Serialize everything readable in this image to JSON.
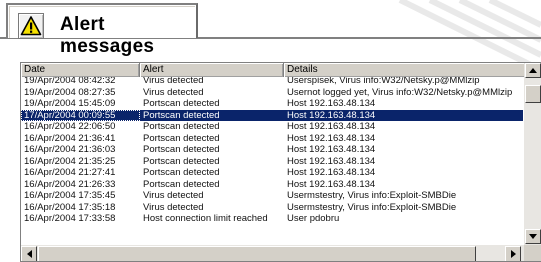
{
  "header": {
    "title": "Alert messages",
    "icon": "warning-triangle-icon"
  },
  "list": {
    "columns": [
      "Date",
      "Alert",
      "Details"
    ],
    "rows": [
      {
        "date": "19/Apr/2004 08:42:32",
        "alert": "Virus detected",
        "details": "Userspisek, Virus info:W32/Netsky.p@MMlzip",
        "selected": false
      },
      {
        "date": "19/Apr/2004 08:27:35",
        "alert": "Virus detected",
        "details": "Usernot logged yet, Virus info:W32/Netsky.p@MMlzip",
        "selected": false
      },
      {
        "date": "19/Apr/2004 15:45:09",
        "alert": "Portscan detected",
        "details": "Host 192.163.48.134",
        "selected": false
      },
      {
        "date": "17/Apr/2004 00:09:55",
        "alert": "Portscan detected",
        "details": "Host 192.163.48.134",
        "selected": true
      },
      {
        "date": "16/Apr/2004 22:06:50",
        "alert": "Portscan detected",
        "details": "Host 192.163.48.134",
        "selected": false
      },
      {
        "date": "16/Apr/2004 21:36:41",
        "alert": "Portscan detected",
        "details": "Host 192.163.48.134",
        "selected": false
      },
      {
        "date": "16/Apr/2004 21:36:03",
        "alert": "Portscan detected",
        "details": "Host 192.163.48.134",
        "selected": false
      },
      {
        "date": "16/Apr/2004 21:35:25",
        "alert": "Portscan detected",
        "details": "Host 192.163.48.134",
        "selected": false
      },
      {
        "date": "16/Apr/2004 21:27:41",
        "alert": "Portscan detected",
        "details": "Host 192.163.48.134",
        "selected": false
      },
      {
        "date": "16/Apr/2004 21:26:33",
        "alert": "Portscan detected",
        "details": "Host 192.163.48.134",
        "selected": false
      },
      {
        "date": "16/Apr/2004 17:35:45",
        "alert": "Virus detected",
        "details": "Usermstestry, Virus info:Exploit-SMBDie",
        "selected": false
      },
      {
        "date": "16/Apr/2004 17:35:18",
        "alert": "Virus detected",
        "details": "Usermstestry, Virus info:Exploit-SMBDie",
        "selected": false
      },
      {
        "date": "16/Apr/2004 17:33:58",
        "alert": "Host connection limit reached",
        "details": "User pdobru",
        "selected": false
      }
    ]
  },
  "colors": {
    "selection": "#0a246a",
    "chrome": "#d4d0c8",
    "warning_yellow": "#f5e000"
  }
}
